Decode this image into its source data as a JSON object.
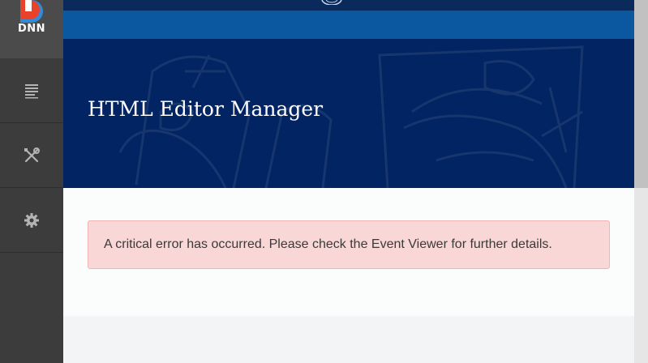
{
  "persona_bar": {
    "logo_text": "DNN",
    "items": [
      {
        "name": "content",
        "icon": "content-list-icon"
      },
      {
        "name": "manage",
        "icon": "tools-icon"
      },
      {
        "name": "settings",
        "icon": "gear-icon"
      }
    ],
    "colors": {
      "bar": "#3c3c3c",
      "logo_bg": "#4b4b4b",
      "icon": "#b4b4b4",
      "logo_red": "#e8412c",
      "logo_blue": "#2e8ddb"
    }
  },
  "header": {
    "colors": {
      "topbar": "#0b2a5c",
      "navbar": "#0b57a0",
      "banner": "#022463"
    }
  },
  "page": {
    "title": "HTML Editor Manager"
  },
  "alert": {
    "type": "error",
    "message": "A critical error has occurred. Please check the Event Viewer for further details.",
    "colors": {
      "background": "#f9d7d7",
      "border": "#f2b4b4",
      "text": "#3a3a3a"
    }
  }
}
